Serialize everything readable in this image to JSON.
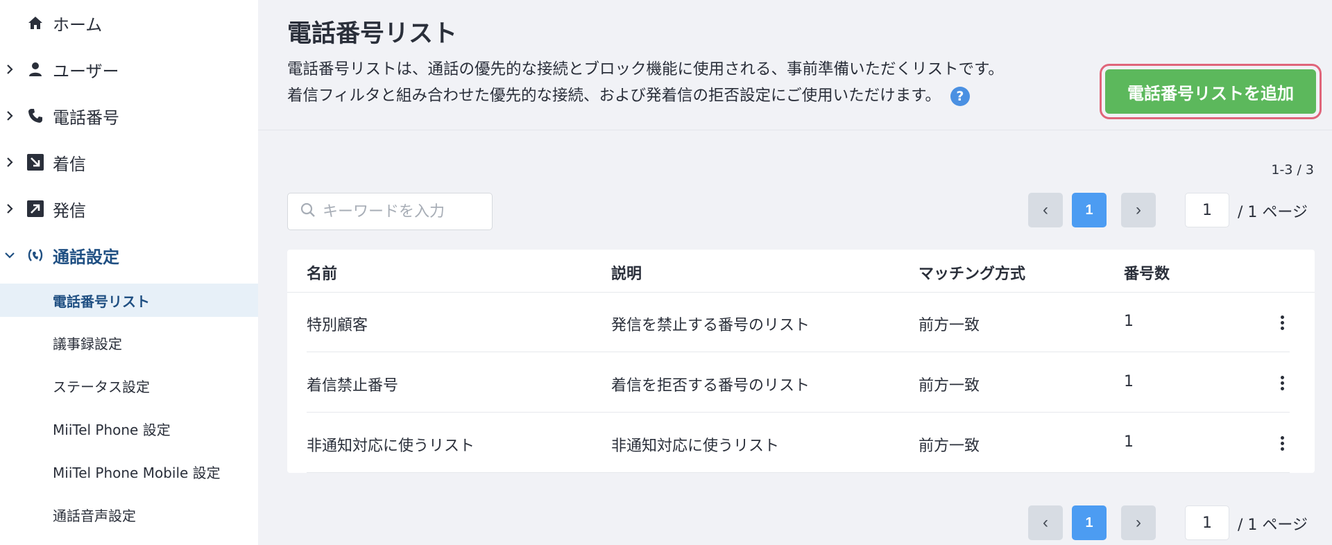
{
  "sidebar": {
    "items": [
      {
        "label": "ホーム",
        "icon": "home-icon"
      },
      {
        "label": "ユーザー",
        "icon": "user-icon"
      },
      {
        "label": "電話番号",
        "icon": "phone-icon"
      },
      {
        "label": "着信",
        "icon": "incoming-call-icon"
      },
      {
        "label": "発信",
        "icon": "outgoing-call-icon"
      },
      {
        "label": "通話設定",
        "icon": "call-settings-icon"
      }
    ],
    "subitems": [
      {
        "label": "電話番号リスト"
      },
      {
        "label": "議事録設定"
      },
      {
        "label": "ステータス設定"
      },
      {
        "label": "MiiTel Phone 設定"
      },
      {
        "label": "MiiTel Phone Mobile 設定"
      },
      {
        "label": "通話音声設定"
      }
    ]
  },
  "header": {
    "title": "電話番号リスト",
    "description_line1": "電話番号リストは、通話の優先的な接続とブロック機能に使用される、事前準備いただくリストです。",
    "description_line2": "着信フィルタと組み合わせた優先的な接続、および発着信の拒否設定にご使用いただけます。",
    "help_glyph": "?",
    "add_button_label": "電話番号リストを追加"
  },
  "controls": {
    "count_text": "1-3 / 3",
    "search_placeholder": "キーワードを入力",
    "pagination": {
      "prev_glyph": "‹",
      "next_glyph": "›",
      "current_page": "1",
      "page_input_value": "1",
      "total_text": "/ 1 ページ"
    }
  },
  "table": {
    "headers": {
      "name": "名前",
      "description": "説明",
      "matching": "マッチング方式",
      "count": "番号数"
    },
    "rows": [
      {
        "name": "特別顧客",
        "description": "発信を禁止する番号のリスト",
        "matching": "前方一致",
        "count": "1"
      },
      {
        "name": "着信禁止番号",
        "description": "着信を拒否する番号のリスト",
        "matching": "前方一致",
        "count": "1"
      },
      {
        "name": "非通知対応に使うリスト",
        "description": "非通知対応に使うリスト",
        "matching": "前方一致",
        "count": "1"
      }
    ]
  },
  "colors": {
    "accent_blue": "#4c9cf2",
    "add_button_green": "#5cb85c",
    "highlight_border": "#e0657a",
    "active_nav": "#1f4f82"
  }
}
